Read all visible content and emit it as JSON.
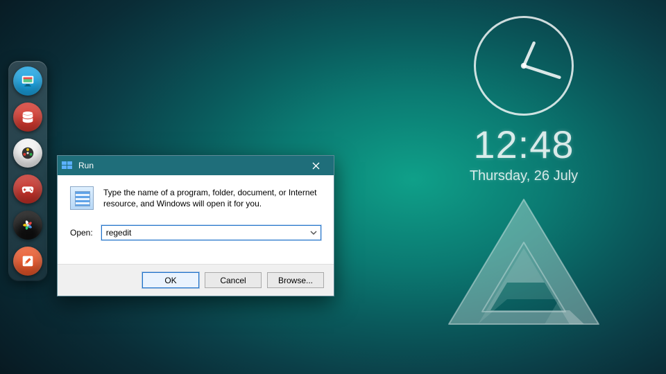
{
  "dock": {
    "items": [
      {
        "name": "monitor",
        "bg": "#1aa2e0",
        "icon_bg": "#ffffff"
      },
      {
        "name": "database",
        "bg": "#d2382e"
      },
      {
        "name": "media",
        "bg": "#f2f2f2"
      },
      {
        "name": "gamepad",
        "bg": "#c4322a"
      },
      {
        "name": "fan",
        "bg": "#111111"
      },
      {
        "name": "editor",
        "bg": "#e8572b"
      }
    ]
  },
  "clock": {
    "time_digital": "12:48",
    "date": "Thursday, 26 July",
    "hour_hand_deg": 24,
    "minute_hand_deg": 108
  },
  "run_dialog": {
    "title": "Run",
    "description": "Type the name of a program, folder, document, or Internet resource, and Windows will open it for you.",
    "open_label": "Open:",
    "open_value": "regedit",
    "buttons": {
      "ok": "OK",
      "cancel": "Cancel",
      "browse": "Browse..."
    }
  }
}
